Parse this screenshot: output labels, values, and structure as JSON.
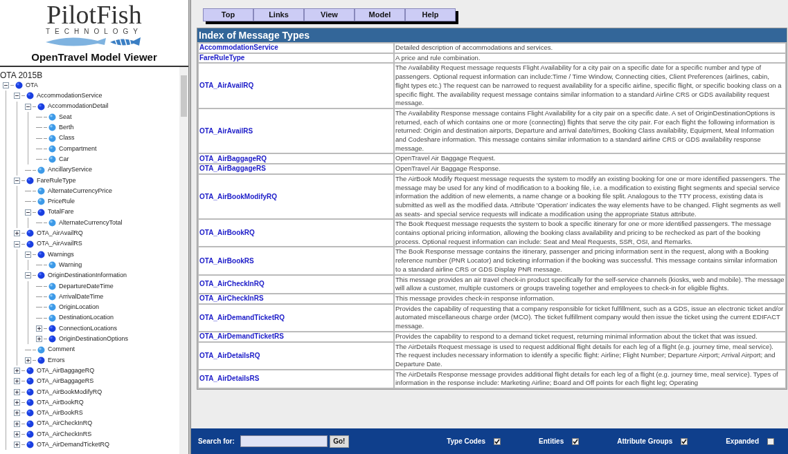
{
  "logo": {
    "name": "PilotFish",
    "tagline": "TECHNOLOGY"
  },
  "app_title": "OpenTravel Model Viewer",
  "tree": {
    "root": "OTA 2015B",
    "items": [
      {
        "label": "OTA",
        "expanded": true,
        "children": [
          {
            "label": "AccommodationService",
            "expanded": true,
            "children": [
              {
                "label": "AccommodationDetail",
                "expanded": true,
                "children": [
                  {
                    "label": "Seat"
                  },
                  {
                    "label": "Berth"
                  },
                  {
                    "label": "Class"
                  },
                  {
                    "label": "Compartment"
                  },
                  {
                    "label": "Car"
                  }
                ]
              },
              {
                "label": "AncillaryService"
              }
            ]
          },
          {
            "label": "FareRuleType",
            "expanded": true,
            "children": [
              {
                "label": "AlternateCurrencyPrice"
              },
              {
                "label": "PriceRule"
              },
              {
                "label": "TotalFare",
                "expanded": true,
                "children": [
                  {
                    "label": "AlternateCurrencyTotal"
                  }
                ]
              }
            ]
          },
          {
            "label": "OTA_AirAvailRQ",
            "expanded": false
          },
          {
            "label": "OTA_AirAvailRS",
            "expanded": true,
            "children": [
              {
                "label": "Warnings",
                "expanded": true,
                "children": [
                  {
                    "label": "Warning"
                  }
                ]
              },
              {
                "label": "OriginDestinationInformation",
                "expanded": true,
                "children": [
                  {
                    "label": "DepartureDateTime"
                  },
                  {
                    "label": "ArrivalDateTime"
                  },
                  {
                    "label": "OriginLocation"
                  },
                  {
                    "label": "DestinationLocation"
                  },
                  {
                    "label": "ConnectionLocations",
                    "expanded": false
                  },
                  {
                    "label": "OriginDestinationOptions",
                    "expanded": false
                  }
                ]
              },
              {
                "label": "Comment"
              },
              {
                "label": "Errors",
                "expanded": false
              }
            ]
          },
          {
            "label": "OTA_AirBaggageRQ",
            "expanded": false
          },
          {
            "label": "OTA_AirBaggageRS",
            "expanded": false
          },
          {
            "label": "OTA_AirBookModifyRQ",
            "expanded": false
          },
          {
            "label": "OTA_AirBookRQ",
            "expanded": false
          },
          {
            "label": "OTA_AirBookRS",
            "expanded": false
          },
          {
            "label": "OTA_AirCheckInRQ",
            "expanded": false
          },
          {
            "label": "OTA_AirCheckInRS",
            "expanded": false
          },
          {
            "label": "OTA_AirDemandTicketRQ",
            "expanded": false
          }
        ]
      }
    ]
  },
  "menu": [
    "Top",
    "Links",
    "View",
    "Model",
    "Help"
  ],
  "table": {
    "title": "Index of Message Types",
    "rows": [
      {
        "name": "AccommodationService",
        "description": "Detailed description of accommodations and services."
      },
      {
        "name": "FareRuleType",
        "description": "A price and rule combination."
      },
      {
        "name": "OTA_AirAvailRQ",
        "description": "The Availability Request message requests Flight Availability for a city pair on a specific date for a specific number and type of passengers. Optional request information can include:Time / Time Window, Connecting cities, Client Preferences (airlines, cabin, flight types etc.) The request can be narrowed to request availability for a specific airline, specific flight, or specific booking class on a specific flight. The availability request message contains similar information to a standard Airline CRS or GDS availability request message."
      },
      {
        "name": "OTA_AirAvailRS",
        "description": "The Availability Response message contains Flight Availability for a city pair on a specific date. A set of OriginDestinationOptions is returned, each of which contains one or more (connecting) flights that serve the city pair. For each flight the following information is returned: Origin and destination airports, Departure and arrival date/times, Booking Class availability, Equipment, Meal Information and Codeshare information. This message contains similar information to a standard airline CRS or GDS availability response message."
      },
      {
        "name": "OTA_AirBaggageRQ",
        "description": "OpenTravel Air Baggage Request."
      },
      {
        "name": "OTA_AirBaggageRS",
        "description": "OpenTravel Air Baggage Response."
      },
      {
        "name": "OTA_AirBookModifyRQ",
        "description": "The AirBook Modify Request message requests the system to modify an existing booking for one or more identified passengers. The message may be used for any kind of modification to a booking file, i.e. a modification to existing flight segments and special service information the addition of new elements, a name change or a booking file split. Analogous to the TTY process, existing data is submitted as well as the modified data. Attribute 'Operation' indicates the way elements have to be changed. Flight segments as well as seats- and special service requests will indicate a modification using the appropriate Status attribute."
      },
      {
        "name": "OTA_AirBookRQ",
        "description": "The Book Request message requests the system to book a specific itinerary for one or more identified passengers. The message contains optional pricing information, allowing the booking class availability and pricing to be rechecked as part of the booking process. Optional request information can include: Seat and Meal Requests, SSR, OSI, and Remarks."
      },
      {
        "name": "OTA_AirBookRS",
        "description": "The Book Response message contains the itinerary, passenger and pricing information sent in the request, along with a Booking reference number (PNR Locator) and ticketing information if the booking was successful. This message contains similar information to a standard airline CRS or GDS Display PNR message."
      },
      {
        "name": "OTA_AirCheckInRQ",
        "description": "This message provides an air travel check-in product specifically for the self-service channels (kiosks, web and mobile). The message will allow a customer, multiple customers or groups traveling together and employees to check-in for eligible flights."
      },
      {
        "name": "OTA_AirCheckInRS",
        "description": "This message provides check-in response information."
      },
      {
        "name": "OTA_AirDemandTicketRQ",
        "description": "Provides the capability of requesting that a company responsible for ticket fulfillment, such as a GDS, issue an electronic ticket and/or automated miscellaneous charge order (MCO). The ticket fulfillment company would then issue the ticket using the current EDIFACT message."
      },
      {
        "name": "OTA_AirDemandTicketRS",
        "description": "Provides the capability to respond to a demand ticket request, returning minimal information about the ticket that was issued."
      },
      {
        "name": "OTA_AirDetailsRQ",
        "description": "The AirDetails Request message is used to request additional flight details for each leg of a flight (e.g. journey time, meal service). The request includes necessary information to identify a specific flight: Airline; Flight Number; Departure Airport; Arrival Airport; and Departure Date."
      },
      {
        "name": "OTA_AirDetailsRS",
        "description": "The AirDetails Response message provides additional flight details for each leg of a flight (e.g. journey time, meal service). Types of information in the response include: Marketing Airline; Board and Off points for each flight leg; Operating"
      }
    ]
  },
  "footer": {
    "search_label": "Search for:",
    "go_button": "Go!",
    "options": [
      {
        "label": "Type Codes",
        "checked": true
      },
      {
        "label": "Entities",
        "checked": true
      },
      {
        "label": "Attribute Groups",
        "checked": true
      },
      {
        "label": "Expanded",
        "checked": false
      }
    ]
  }
}
